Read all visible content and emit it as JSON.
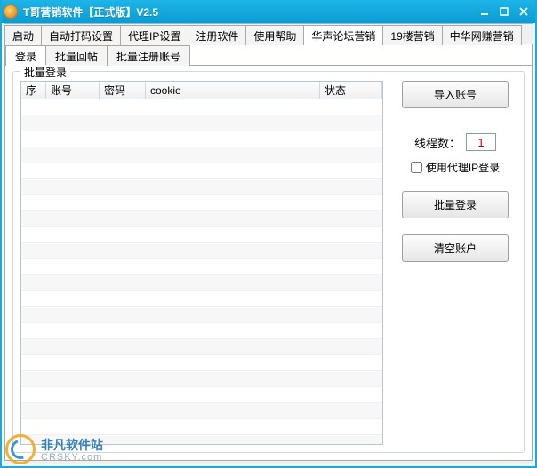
{
  "window": {
    "title": "T哥营销软件【正式版】V2.5"
  },
  "tabs1": [
    "启动",
    "自动打码设置",
    "代理IP设置",
    "注册软件",
    "使用帮助",
    "华声论坛营销",
    "19楼营销",
    "中华网赚营销"
  ],
  "tabs1_active": 5,
  "tabs2": [
    "登录",
    "批量回帖",
    "批量注册账号"
  ],
  "tabs2_active": 0,
  "groupbox": {
    "legend": "批量登录"
  },
  "columns": {
    "idx": "序",
    "acct": "账号",
    "pwd": "密码",
    "cookie": "cookie",
    "status": "状态"
  },
  "right": {
    "import_btn": "导入账号",
    "thread_label": "线程数：",
    "thread_value": "1",
    "use_proxy_label": "使用代理IP登录",
    "bulk_login_btn": "批量登录",
    "clear_btn": "清空账户"
  },
  "watermark": {
    "line1": "非凡软件站",
    "line2": "CRSKY.com"
  }
}
